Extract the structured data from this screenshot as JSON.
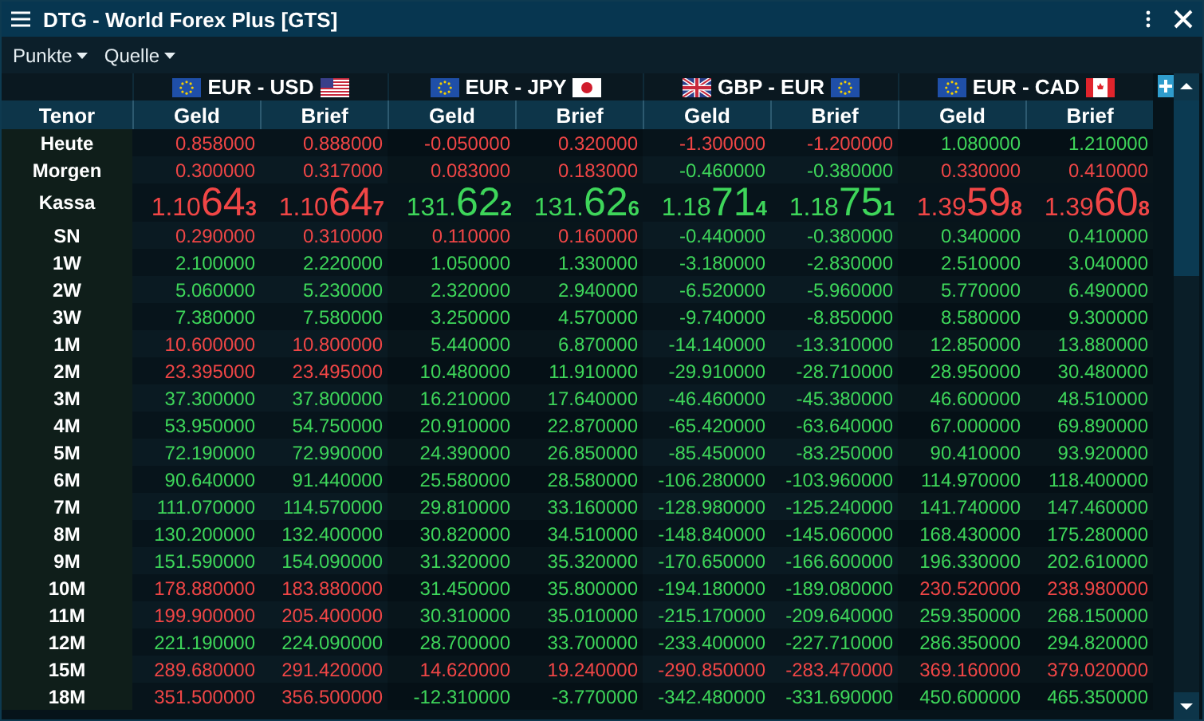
{
  "window": {
    "title": "DTG - World Forex Plus [GTS]"
  },
  "toolbar": [
    {
      "label": "Punkte"
    },
    {
      "label": "Quelle"
    }
  ],
  "pairs": [
    {
      "label": "EUR - USD",
      "flags": [
        {
          "kind": "eu"
        },
        {
          "kind": "us"
        }
      ]
    },
    {
      "label": "EUR - JPY",
      "flags": [
        {
          "kind": "eu"
        },
        {
          "kind": "jp"
        }
      ]
    },
    {
      "label": "GBP - EUR",
      "flags": [
        {
          "kind": "gb"
        },
        {
          "kind": "eu"
        }
      ]
    },
    {
      "label": "EUR - CAD",
      "flags": [
        {
          "kind": "eu"
        },
        {
          "kind": "ca"
        }
      ]
    }
  ],
  "columns": [
    "Tenor",
    "Geld",
    "Brief",
    "Geld",
    "Brief",
    "Geld",
    "Brief",
    "Geld",
    "Brief"
  ],
  "rows": [
    {
      "tenor": "Heute",
      "cells": [
        {
          "value": "0.858000",
          "up": false
        },
        {
          "value": "0.888000",
          "up": false
        },
        {
          "value": "-0.050000",
          "up": false
        },
        {
          "value": "0.320000",
          "up": false
        },
        {
          "value": "-1.300000",
          "up": false
        },
        {
          "value": "-1.200000",
          "up": false
        },
        {
          "value": "1.080000",
          "up": true
        },
        {
          "value": "1.210000",
          "up": true
        }
      ]
    },
    {
      "tenor": "Morgen",
      "cells": [
        {
          "value": "0.300000",
          "up": false
        },
        {
          "value": "0.317000",
          "up": false
        },
        {
          "value": "0.083000",
          "up": false
        },
        {
          "value": "0.183000",
          "up": false
        },
        {
          "value": "-0.460000",
          "up": true
        },
        {
          "value": "-0.380000",
          "up": true
        },
        {
          "value": "0.330000",
          "up": false
        },
        {
          "value": "0.410000",
          "up": false
        }
      ]
    },
    {
      "tenor": "Kassa",
      "kind": "spot",
      "cells": [
        {
          "lead": "1.10",
          "pips": "64",
          "tail": "3",
          "up": false
        },
        {
          "lead": "1.10",
          "pips": "64",
          "tail": "7",
          "up": false
        },
        {
          "lead": "131.",
          "pips": "62",
          "tail": "2",
          "up": true
        },
        {
          "lead": "131.",
          "pips": "62",
          "tail": "6",
          "up": true
        },
        {
          "lead": "1.18",
          "pips": "71",
          "tail": "4",
          "up": true
        },
        {
          "lead": "1.18",
          "pips": "75",
          "tail": "1",
          "up": true
        },
        {
          "lead": "1.39",
          "pips": "59",
          "tail": "8",
          "up": false
        },
        {
          "lead": "1.39",
          "pips": "60",
          "tail": "8",
          "up": false
        }
      ]
    },
    {
      "tenor": "SN",
      "cells": [
        {
          "value": "0.290000",
          "up": false
        },
        {
          "value": "0.310000",
          "up": false
        },
        {
          "value": "0.110000",
          "up": false
        },
        {
          "value": "0.160000",
          "up": false
        },
        {
          "value": "-0.440000",
          "up": true
        },
        {
          "value": "-0.380000",
          "up": true
        },
        {
          "value": "0.340000",
          "up": true
        },
        {
          "value": "0.410000",
          "up": true
        }
      ]
    },
    {
      "tenor": "1W",
      "cells": [
        {
          "value": "2.100000",
          "up": true
        },
        {
          "value": "2.220000",
          "up": true
        },
        {
          "value": "1.050000",
          "up": true
        },
        {
          "value": "1.330000",
          "up": true
        },
        {
          "value": "-3.180000",
          "up": true
        },
        {
          "value": "-2.830000",
          "up": true
        },
        {
          "value": "2.510000",
          "up": true
        },
        {
          "value": "3.040000",
          "up": true
        }
      ]
    },
    {
      "tenor": "2W",
      "cells": [
        {
          "value": "5.060000",
          "up": true
        },
        {
          "value": "5.230000",
          "up": true
        },
        {
          "value": "2.320000",
          "up": true
        },
        {
          "value": "2.940000",
          "up": true
        },
        {
          "value": "-6.520000",
          "up": true
        },
        {
          "value": "-5.960000",
          "up": true
        },
        {
          "value": "5.770000",
          "up": true
        },
        {
          "value": "6.490000",
          "up": true
        }
      ]
    },
    {
      "tenor": "3W",
      "cells": [
        {
          "value": "7.380000",
          "up": true
        },
        {
          "value": "7.580000",
          "up": true
        },
        {
          "value": "3.250000",
          "up": true
        },
        {
          "value": "4.570000",
          "up": true
        },
        {
          "value": "-9.740000",
          "up": true
        },
        {
          "value": "-8.850000",
          "up": true
        },
        {
          "value": "8.580000",
          "up": true
        },
        {
          "value": "9.300000",
          "up": true
        }
      ]
    },
    {
      "tenor": "1M",
      "cells": [
        {
          "value": "10.600000",
          "up": false
        },
        {
          "value": "10.800000",
          "up": false
        },
        {
          "value": "5.440000",
          "up": true
        },
        {
          "value": "6.870000",
          "up": true
        },
        {
          "value": "-14.140000",
          "up": true
        },
        {
          "value": "-13.310000",
          "up": true
        },
        {
          "value": "12.850000",
          "up": true
        },
        {
          "value": "13.880000",
          "up": true
        }
      ]
    },
    {
      "tenor": "2M",
      "cells": [
        {
          "value": "23.395000",
          "up": false
        },
        {
          "value": "23.495000",
          "up": false
        },
        {
          "value": "10.480000",
          "up": true
        },
        {
          "value": "11.910000",
          "up": true
        },
        {
          "value": "-29.910000",
          "up": true
        },
        {
          "value": "-28.710000",
          "up": true
        },
        {
          "value": "28.950000",
          "up": true
        },
        {
          "value": "30.480000",
          "up": true
        }
      ]
    },
    {
      "tenor": "3M",
      "cells": [
        {
          "value": "37.300000",
          "up": true
        },
        {
          "value": "37.800000",
          "up": true
        },
        {
          "value": "16.210000",
          "up": true
        },
        {
          "value": "17.640000",
          "up": true
        },
        {
          "value": "-46.460000",
          "up": true
        },
        {
          "value": "-45.380000",
          "up": true
        },
        {
          "value": "46.600000",
          "up": true
        },
        {
          "value": "48.510000",
          "up": true
        }
      ]
    },
    {
      "tenor": "4M",
      "cells": [
        {
          "value": "53.950000",
          "up": true
        },
        {
          "value": "54.750000",
          "up": true
        },
        {
          "value": "20.910000",
          "up": true
        },
        {
          "value": "22.870000",
          "up": true
        },
        {
          "value": "-65.420000",
          "up": true
        },
        {
          "value": "-63.640000",
          "up": true
        },
        {
          "value": "67.000000",
          "up": true
        },
        {
          "value": "69.890000",
          "up": true
        }
      ]
    },
    {
      "tenor": "5M",
      "cells": [
        {
          "value": "72.190000",
          "up": true
        },
        {
          "value": "72.990000",
          "up": true
        },
        {
          "value": "24.390000",
          "up": true
        },
        {
          "value": "26.850000",
          "up": true
        },
        {
          "value": "-85.450000",
          "up": true
        },
        {
          "value": "-83.250000",
          "up": true
        },
        {
          "value": "90.410000",
          "up": true
        },
        {
          "value": "93.920000",
          "up": true
        }
      ]
    },
    {
      "tenor": "6M",
      "cells": [
        {
          "value": "90.640000",
          "up": true
        },
        {
          "value": "91.440000",
          "up": true
        },
        {
          "value": "25.580000",
          "up": true
        },
        {
          "value": "28.580000",
          "up": true
        },
        {
          "value": "-106.280000",
          "up": true
        },
        {
          "value": "-103.960000",
          "up": true
        },
        {
          "value": "114.970000",
          "up": true
        },
        {
          "value": "118.400000",
          "up": true
        }
      ]
    },
    {
      "tenor": "7M",
      "cells": [
        {
          "value": "111.070000",
          "up": true
        },
        {
          "value": "114.570000",
          "up": true
        },
        {
          "value": "29.810000",
          "up": true
        },
        {
          "value": "33.160000",
          "up": true
        },
        {
          "value": "-128.980000",
          "up": true
        },
        {
          "value": "-125.240000",
          "up": true
        },
        {
          "value": "141.740000",
          "up": true
        },
        {
          "value": "147.460000",
          "up": true
        }
      ]
    },
    {
      "tenor": "8M",
      "cells": [
        {
          "value": "130.200000",
          "up": true
        },
        {
          "value": "132.400000",
          "up": true
        },
        {
          "value": "30.820000",
          "up": true
        },
        {
          "value": "34.510000",
          "up": true
        },
        {
          "value": "-148.840000",
          "up": true
        },
        {
          "value": "-145.060000",
          "up": true
        },
        {
          "value": "168.430000",
          "up": true
        },
        {
          "value": "175.280000",
          "up": true
        }
      ]
    },
    {
      "tenor": "9M",
      "cells": [
        {
          "value": "151.590000",
          "up": true
        },
        {
          "value": "154.090000",
          "up": true
        },
        {
          "value": "31.320000",
          "up": true
        },
        {
          "value": "35.320000",
          "up": true
        },
        {
          "value": "-170.650000",
          "up": true
        },
        {
          "value": "-166.600000",
          "up": true
        },
        {
          "value": "196.330000",
          "up": true
        },
        {
          "value": "202.610000",
          "up": true
        }
      ]
    },
    {
      "tenor": "10M",
      "cells": [
        {
          "value": "178.880000",
          "up": false
        },
        {
          "value": "183.880000",
          "up": false
        },
        {
          "value": "31.450000",
          "up": true
        },
        {
          "value": "35.800000",
          "up": true
        },
        {
          "value": "-194.180000",
          "up": true
        },
        {
          "value": "-189.080000",
          "up": true
        },
        {
          "value": "230.520000",
          "up": false
        },
        {
          "value": "238.980000",
          "up": false
        }
      ]
    },
    {
      "tenor": "11M",
      "cells": [
        {
          "value": "199.900000",
          "up": false
        },
        {
          "value": "205.400000",
          "up": false
        },
        {
          "value": "30.310000",
          "up": true
        },
        {
          "value": "35.010000",
          "up": true
        },
        {
          "value": "-215.170000",
          "up": true
        },
        {
          "value": "-209.640000",
          "up": true
        },
        {
          "value": "259.350000",
          "up": true
        },
        {
          "value": "268.150000",
          "up": true
        }
      ]
    },
    {
      "tenor": "12M",
      "cells": [
        {
          "value": "221.190000",
          "up": true
        },
        {
          "value": "224.090000",
          "up": true
        },
        {
          "value": "28.700000",
          "up": true
        },
        {
          "value": "33.700000",
          "up": true
        },
        {
          "value": "-233.400000",
          "up": true
        },
        {
          "value": "-227.710000",
          "up": true
        },
        {
          "value": "286.350000",
          "up": true
        },
        {
          "value": "294.820000",
          "up": true
        }
      ]
    },
    {
      "tenor": "15M",
      "cells": [
        {
          "value": "289.680000",
          "up": false
        },
        {
          "value": "291.420000",
          "up": false
        },
        {
          "value": "14.620000",
          "up": false
        },
        {
          "value": "19.240000",
          "up": false
        },
        {
          "value": "-290.850000",
          "up": false
        },
        {
          "value": "-283.470000",
          "up": false
        },
        {
          "value": "369.160000",
          "up": false
        },
        {
          "value": "379.020000",
          "up": false
        }
      ]
    },
    {
      "tenor": "18M",
      "cells": [
        {
          "value": "351.500000",
          "up": false
        },
        {
          "value": "356.500000",
          "up": false
        },
        {
          "value": "-12.310000",
          "up": true
        },
        {
          "value": "-3.770000",
          "up": true
        },
        {
          "value": "-342.480000",
          "up": true
        },
        {
          "value": "-331.690000",
          "up": true
        },
        {
          "value": "450.600000",
          "up": true
        },
        {
          "value": "465.350000",
          "up": true
        }
      ]
    }
  ]
}
